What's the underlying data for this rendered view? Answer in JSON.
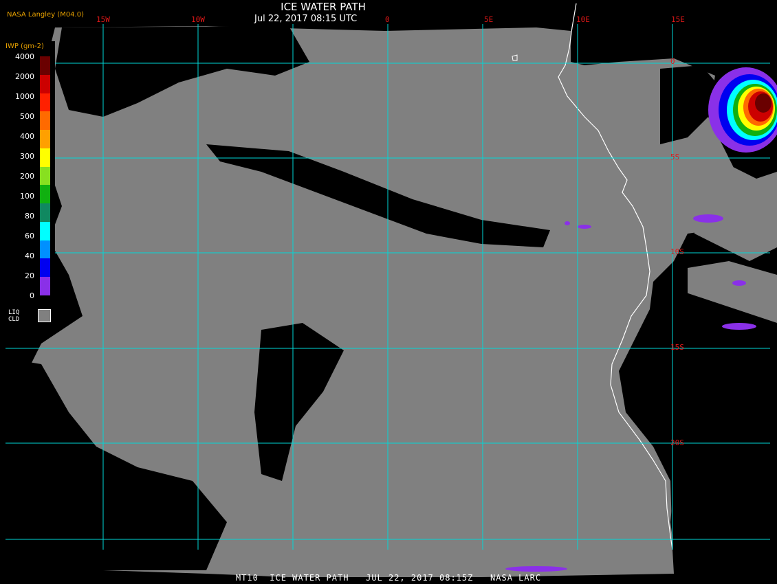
{
  "map": {
    "title": "ICE WATER PATH",
    "subtitle": "Jul 22, 2017 08:15 UTC",
    "source": "NASA Langley (M04.0)",
    "footer": "MT10  ICE WATER PATH   JUL 22, 2017 08:15Z   NASA LARC",
    "longitude_labels": [
      "15W",
      "10W",
      "0",
      "5E",
      "10E",
      "15E"
    ],
    "latitude_labels": [
      "0",
      "5S",
      "10S",
      "15S",
      "20S"
    ],
    "colors": {
      "ocean_clear": "#000000",
      "liquid_cloud": "#808080",
      "gridline": "#00d8d8",
      "coastline": "#ffffff",
      "grid_label": "#e01818",
      "legend_title": "#e6a000"
    }
  },
  "legend": {
    "title": "IWP (gm-2)",
    "ticks": [
      "4000",
      "2000",
      "1000",
      "500",
      "400",
      "300",
      "200",
      "100",
      "80",
      "60",
      "40",
      "20",
      "0"
    ],
    "swatches": [
      "#6a0000",
      "#cc0000",
      "#ff2000",
      "#ff6a00",
      "#ffa000",
      "#ffff00",
      "#88e020",
      "#10b010",
      "#108860",
      "#00ffff",
      "#0090ff",
      "#0000f0",
      "#8a30e8"
    ],
    "liq_label_1": "LIQ",
    "liq_label_2": "CLD"
  }
}
